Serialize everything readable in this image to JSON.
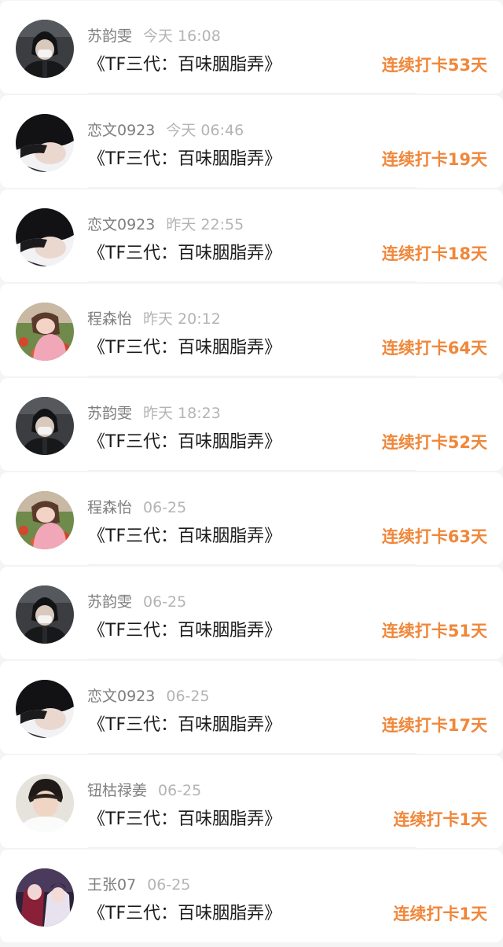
{
  "feed": {
    "items": [
      {
        "username": "苏韵雯",
        "time": "今天 16:08",
        "book_title": "《TF三代：百味胭脂弄》",
        "streak": "连续打卡53天",
        "avatar": "masked-boy-avatar"
      },
      {
        "username": "恋文0923",
        "time": "今天 06:46",
        "book_title": "《TF三代：百味胭脂弄》",
        "streak": "连续打卡19天",
        "avatar": "black-hair-boy-avatar"
      },
      {
        "username": "恋文0923",
        "time": "昨天 22:55",
        "book_title": "《TF三代：百味胭脂弄》",
        "streak": "连续打卡18天",
        "avatar": "black-hair-boy-avatar"
      },
      {
        "username": "程森怡",
        "time": "昨天 20:12",
        "book_title": "《TF三代：百味胭脂弄》",
        "streak": "连续打卡64天",
        "avatar": "flower-girl-avatar"
      },
      {
        "username": "苏韵雯",
        "time": "昨天 18:23",
        "book_title": "《TF三代：百味胭脂弄》",
        "streak": "连续打卡52天",
        "avatar": "masked-boy-avatar"
      },
      {
        "username": "程森怡",
        "time": "06-25",
        "book_title": "《TF三代：百味胭脂弄》",
        "streak": "连续打卡63天",
        "avatar": "flower-girl-avatar"
      },
      {
        "username": "苏韵雯",
        "time": "06-25",
        "book_title": "《TF三代：百味胭脂弄》",
        "streak": "连续打卡51天",
        "avatar": "masked-boy-avatar"
      },
      {
        "username": "恋文0923",
        "time": "06-25",
        "book_title": "《TF三代：百味胭脂弄》",
        "streak": "连续打卡17天",
        "avatar": "black-hair-boy-avatar"
      },
      {
        "username": "钮枯禄姜",
        "time": "06-25",
        "book_title": "《TF三代：百味胭脂弄》",
        "streak": "连续打卡1天",
        "avatar": "white-shirt-boy-avatar"
      },
      {
        "username": "王张07",
        "time": "06-25",
        "book_title": "《TF三代：百味胭脂弄》",
        "streak": "连续打卡1天",
        "avatar": "costume-couple-avatar"
      }
    ]
  },
  "colors": {
    "background": "#f4f4f4",
    "card": "#ffffff",
    "username": "#7e7e7e",
    "time": "#b4b4b4",
    "title": "#1b1b1b",
    "streak_accent": "#f0873a"
  }
}
